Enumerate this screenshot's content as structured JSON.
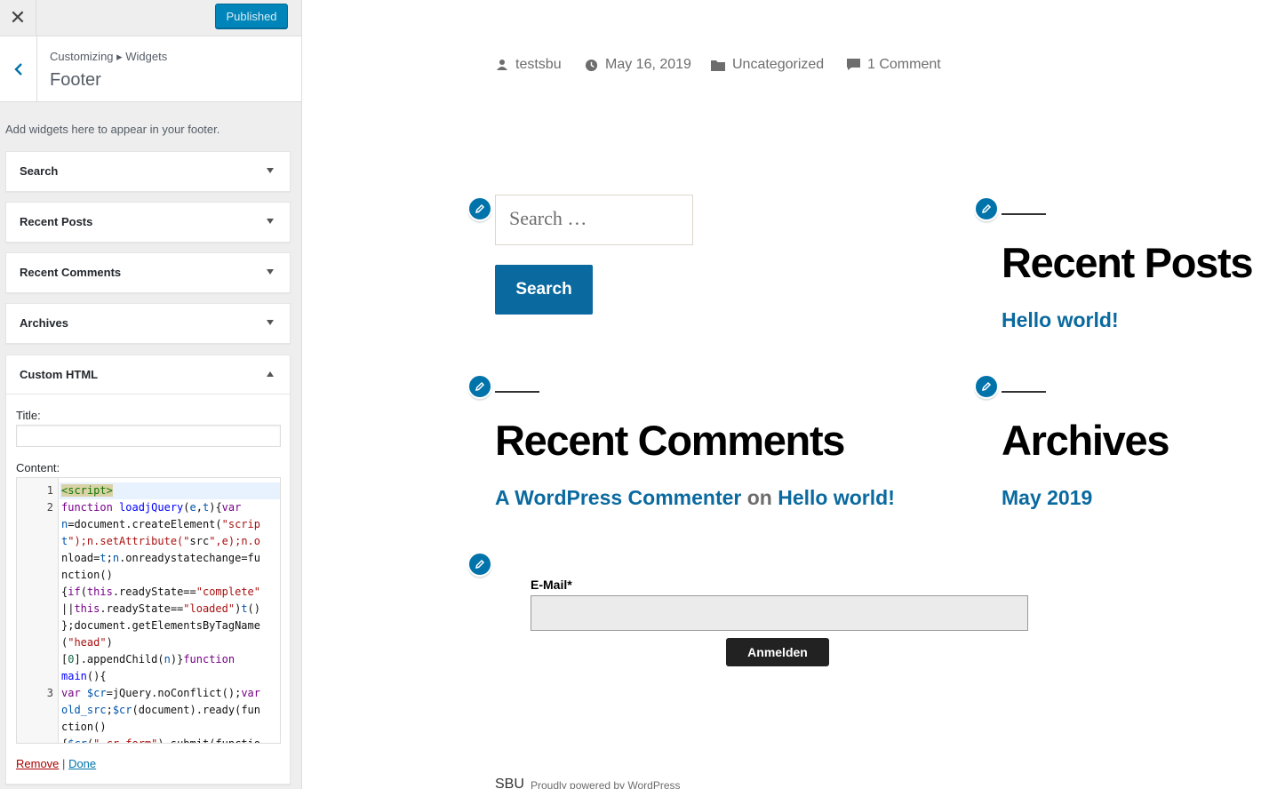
{
  "customizer": {
    "close_icon": "close-icon",
    "publish_label": "Published",
    "breadcrumb": "Customizing ▸ Widgets",
    "section_title": "Footer",
    "section_description": "Add widgets here to appear in your footer.",
    "widgets": [
      {
        "title": "Search",
        "expanded": false
      },
      {
        "title": "Recent Posts",
        "expanded": false
      },
      {
        "title": "Recent Comments",
        "expanded": false
      },
      {
        "title": "Archives",
        "expanded": false
      },
      {
        "title": "Custom HTML",
        "expanded": true
      }
    ],
    "custom_html": {
      "title_label": "Title:",
      "title_value": "",
      "content_label": "Content:",
      "line_numbers": [
        "1",
        "2",
        "3"
      ],
      "code_lines": [
        "<script>",
        "function loadjQuery(e,t){var",
        "n=document.createElement(\"scrip",
        "t\");n.setAttribute(\"src\",e);n.o",
        "nload=t;n.onreadystatechange=fu",
        "nction()",
        "{if(this.readyState==\"complete\"",
        "||this.readyState==\"loaded\")t()",
        "};document.getElementsByTagName",
        "(\"head\")",
        "[0].appendChild(n)}function",
        "main(){",
        "var $cr=jQuery.noConflict();var",
        "old_src;$cr(document).ready(fun",
        "ction()",
        "{$cr(\".cr_form\").submit(functio"
      ],
      "remove_label": "Remove",
      "separator": "|",
      "done_label": "Done"
    }
  },
  "preview": {
    "post_meta": {
      "author": "testsbu",
      "date": "May 16, 2019",
      "category": "Uncategorized",
      "comments": "1 Comment"
    },
    "search_widget": {
      "placeholder": "Search …",
      "button_label": "Search"
    },
    "recent_posts": {
      "heading": "Recent Posts",
      "items": [
        "Hello world!"
      ]
    },
    "recent_comments": {
      "heading": "Recent Comments",
      "author": "A WordPress Commenter",
      "on_word": "on",
      "post": "Hello world!"
    },
    "archives": {
      "heading": "Archives",
      "items": [
        "May 2019"
      ]
    },
    "newsletter": {
      "email_label": "E-Mail*",
      "email_value": "",
      "submit_label": "Anmelden"
    },
    "footer": {
      "site_name": "SBU",
      "powered_by": "Proudly powered by WordPress"
    },
    "colors": {
      "accent": "#0a6a9f",
      "customizer_primary": "#0085ba",
      "edit_shortcut": "#0073aa"
    }
  }
}
